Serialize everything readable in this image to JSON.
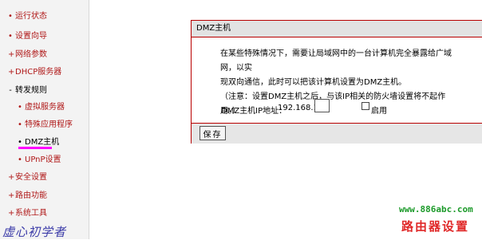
{
  "sidebar": {
    "items": [
      {
        "label": "运行状态",
        "bullet": "•"
      },
      {
        "label": "设置向导",
        "bullet": "•"
      },
      {
        "label": "网络参数",
        "bullet": "+"
      },
      {
        "label": "DHCP服务器",
        "bullet": "+"
      },
      {
        "label": "转发规则",
        "bullet": "-"
      },
      {
        "label": "虚拟服务器",
        "bullet": "•"
      },
      {
        "label": "特殊应用程序",
        "bullet": "•"
      },
      {
        "label": "DMZ主机",
        "bullet": "•"
      },
      {
        "label": "UPnP设置",
        "bullet": "•"
      },
      {
        "label": "安全设置",
        "bullet": "+"
      },
      {
        "label": "路由功能",
        "bullet": "+"
      },
      {
        "label": "系统工具",
        "bullet": "+"
      }
    ],
    "watermark": "虚心初学者"
  },
  "panel": {
    "title": "DMZ主机",
    "description_line1": "在某些特殊情况下，需要让局域网中的一台计算机完全暴露给广域网，以实",
    "description_line2": "现双向通信，此时可以把该计算机设置为DMZ主机。",
    "description_line3": "（注意：设置DMZ主机之后，与该IP相关的防火墙设置将不起作用。）",
    "ip_label": "DMZ主机IP地址：",
    "ip_prefix": "192.168.1.",
    "ip_value": "",
    "enable_label": "启用",
    "enable_checked": false,
    "save_label": "保存"
  },
  "watermark": {
    "url": "www.886abc.com",
    "text": "路由器设置"
  },
  "colors": {
    "nav_text": "#b01818",
    "panel_border": "#b80000",
    "active_underline": "#ff00ff",
    "watermark_url": "#1c9a2a",
    "watermark_text": "#e02828"
  }
}
